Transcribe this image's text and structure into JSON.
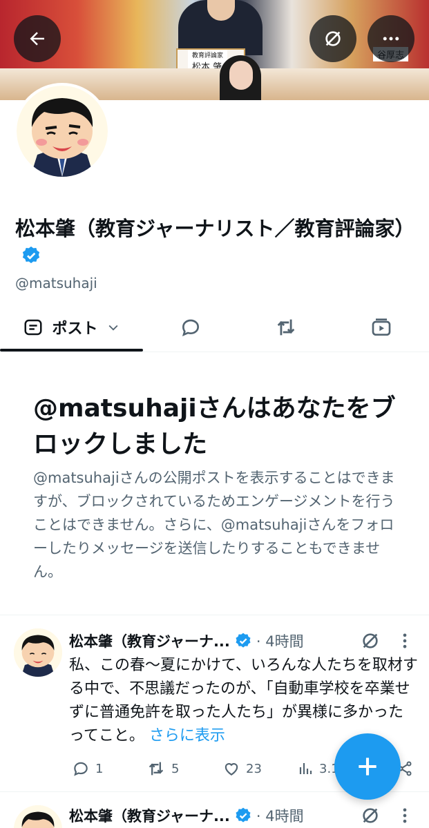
{
  "banner": {
    "namecard_role": "教育評論家",
    "namecard_name": "松本 肇",
    "namecard2_name": "谷厚志"
  },
  "profile": {
    "name": "松本肇（教育ジャーナリスト／教育評論家）",
    "handle": "@matsuhaji",
    "verified": true
  },
  "tabs": [
    {
      "label": "ポスト",
      "icon": "posts-icon",
      "active": true
    },
    {
      "label": "",
      "icon": "reply-icon"
    },
    {
      "label": "",
      "icon": "repost-icon"
    },
    {
      "label": "",
      "icon": "media-icon"
    }
  ],
  "blocked": {
    "title": "@matsuhajiさんはあなたをブロックしました",
    "description": "@matsuhajiさんの公開ポストを表示することはできますが、ブロックされているためエンゲージメントを行うことはできません。さらに、@matsuhajiさんをフォローしたりメッセージを送信したりすることもできません。"
  },
  "posts": [
    {
      "author": "松本肇（教育ジャーナ...",
      "time": "· 4時間",
      "body": "私、この春〜夏にかけて、いろんな人たちを取材する中で、不思議だったのが、「自動車学校を卒業せずに普通免許を取った人たち」が異様に多かったってこと。",
      "more": "さらに表示",
      "replies": "1",
      "reposts": "5",
      "likes": "23",
      "views": "3.1"
    },
    {
      "author": "松本肇（教育ジャーナ...",
      "time": "· 4時間"
    }
  ],
  "colors": {
    "accent": "#1d9bf0",
    "text": "#0f1419",
    "muted": "#536471"
  }
}
